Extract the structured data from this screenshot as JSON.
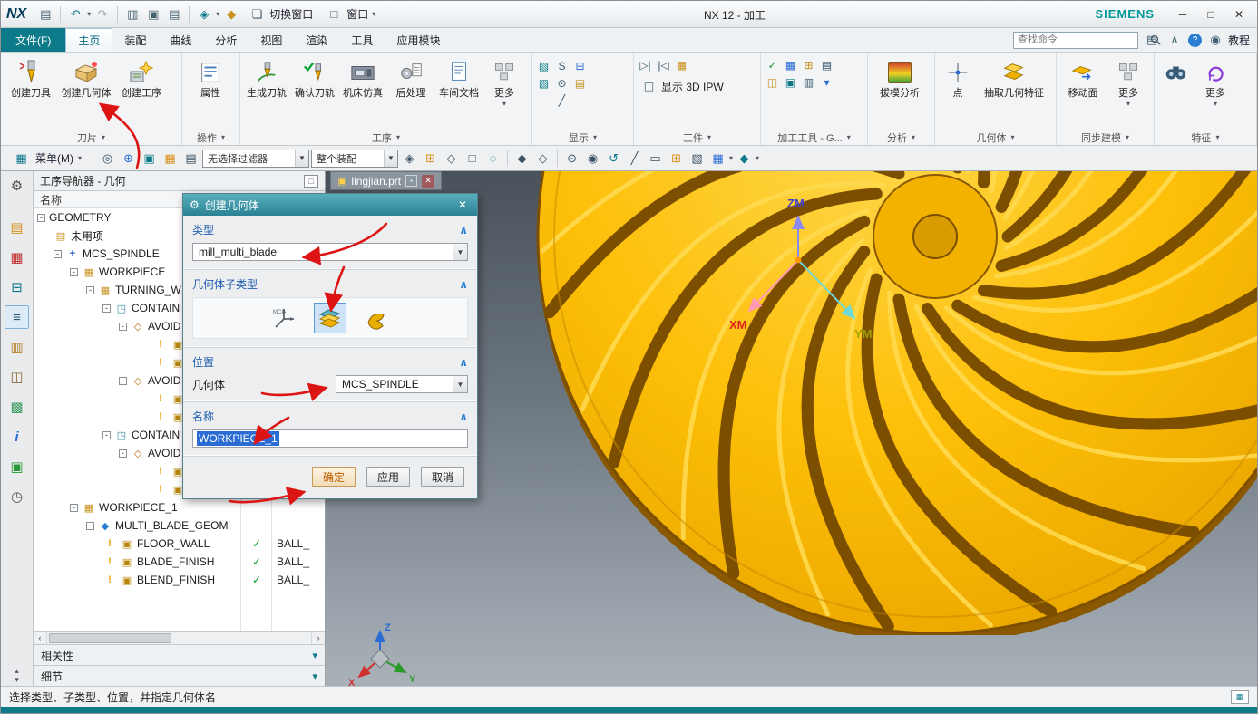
{
  "icons": {
    "minimize": "─",
    "maximize": "□",
    "close": "✕"
  },
  "titlebar": {
    "logo": "NX",
    "title": "NX 12 - 加工",
    "brand": "SIEMENS",
    "switch_window": "切换窗口",
    "window_menu": "窗口"
  },
  "ribbon_tabs": {
    "file": "文件(F)",
    "items": [
      "主页",
      "装配",
      "曲线",
      "分析",
      "视图",
      "渲染",
      "工具",
      "应用模块"
    ]
  },
  "search": {
    "placeholder": "查找命令",
    "tutorial": "教程"
  },
  "ribbon": {
    "groups": [
      {
        "label": "刀片",
        "items": [
          "创建刀具",
          "创建几何体",
          "创建工序"
        ]
      },
      {
        "label": "操作",
        "items": [
          "属性"
        ]
      },
      {
        "label": "工序",
        "items": [
          "生成刀轨",
          "确认刀轨",
          "机床仿真",
          "后处理",
          "车间文档",
          "更多"
        ]
      },
      {
        "label": "显示",
        "items": []
      },
      {
        "label": "工件",
        "items": [
          "显示 3D IPW"
        ]
      },
      {
        "label": "加工工具 - G...",
        "items": []
      },
      {
        "label": "分析",
        "items": [
          "拔模分析"
        ]
      },
      {
        "label": "几何体",
        "items": [
          "点",
          "抽取几何特征"
        ]
      },
      {
        "label": "同步建模",
        "items": [
          "移动面",
          "更多"
        ]
      },
      {
        "label": "特征",
        "items": [
          "更多"
        ]
      }
    ]
  },
  "toolbar": {
    "menu": "菜单(M)",
    "selection_filter": "无选择过滤器",
    "scope": "整个装配"
  },
  "navigator": {
    "title": "工序导航器 - 几何",
    "name_column": "名称",
    "dependencies": "相关性",
    "details": "细节",
    "tree": [
      {
        "label": "GEOMETRY"
      },
      {
        "label": "未用项"
      },
      {
        "label": "MCS_SPINDLE"
      },
      {
        "label": "WORKPIECE"
      },
      {
        "label": "TURNING_W"
      },
      {
        "label": "CONTAIN"
      },
      {
        "label": "AVOID"
      },
      {
        "label": ""
      },
      {
        "label": ""
      },
      {
        "label": "AVOID"
      },
      {
        "label": ""
      },
      {
        "label": ""
      },
      {
        "label": "CONTAIN"
      },
      {
        "label": "AVOID"
      },
      {
        "label": ""
      },
      {
        "label": ""
      },
      {
        "label": "WORKPIECE_1"
      },
      {
        "label": "MULTI_BLADE_GEOM"
      },
      {
        "label": "FLOOR_WALL",
        "check": "✓",
        "tool": "BALL_"
      },
      {
        "label": "BLADE_FINISH",
        "check": "✓",
        "tool": "BALL_"
      },
      {
        "label": "BLEND_FINISH",
        "check": "✓",
        "tool": "BALL_"
      }
    ]
  },
  "dialog": {
    "title": "创建几何体",
    "type_label": "类型",
    "type_value": "mill_multi_blade",
    "subtype_label": "几何体子类型",
    "location_label": "位置",
    "geometry_label": "几何体",
    "location_value": "MCS_SPINDLE",
    "name_label": "名称",
    "name_value": "WORKPIECE_1",
    "ok": "确定",
    "apply": "应用",
    "cancel": "取消"
  },
  "viewport": {
    "tab": "lingjian.prt",
    "axis_zm": "ZM",
    "axis_xm": "XM",
    "axis_ym": "YM",
    "triad_x": "X",
    "triad_y": "Y",
    "triad_z": "Z"
  },
  "statusbar": {
    "message": "选择类型、子类型、位置，并指定几何体名"
  }
}
